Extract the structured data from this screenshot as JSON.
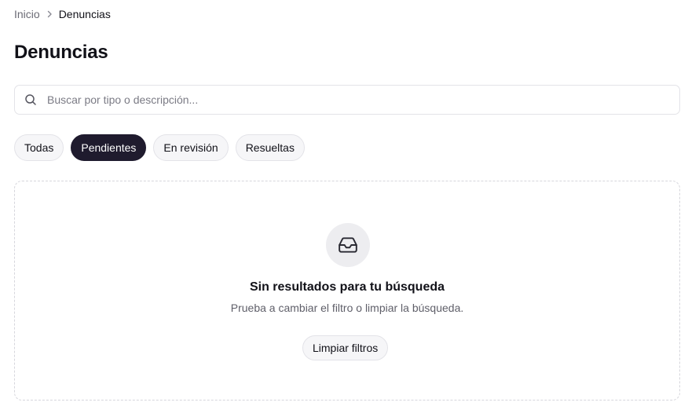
{
  "breadcrumb": {
    "home": "Inicio",
    "current": "Denuncias",
    "separator_icon": "chevron-right-icon"
  },
  "page": {
    "title": "Denuncias"
  },
  "search": {
    "placeholder": "Buscar por tipo o descripción...",
    "value": "",
    "icon": "search-icon"
  },
  "filters": {
    "items": [
      {
        "label": "Todas",
        "active": false
      },
      {
        "label": "Pendientes",
        "active": true
      },
      {
        "label": "En revisión",
        "active": false
      },
      {
        "label": "Resueltas",
        "active": false
      }
    ]
  },
  "empty_state": {
    "icon": "inbox-icon",
    "title": "Sin resultados para tu búsqueda",
    "subtitle": "Prueba a cambiar el filtro o limpiar la búsqueda.",
    "action_label": "Limpiar filtros"
  },
  "colors": {
    "accent": "#1f1b2e",
    "chip_bg": "#f6f6f8",
    "border": "#e3e3e8",
    "muted_text": "#6b6b75"
  }
}
